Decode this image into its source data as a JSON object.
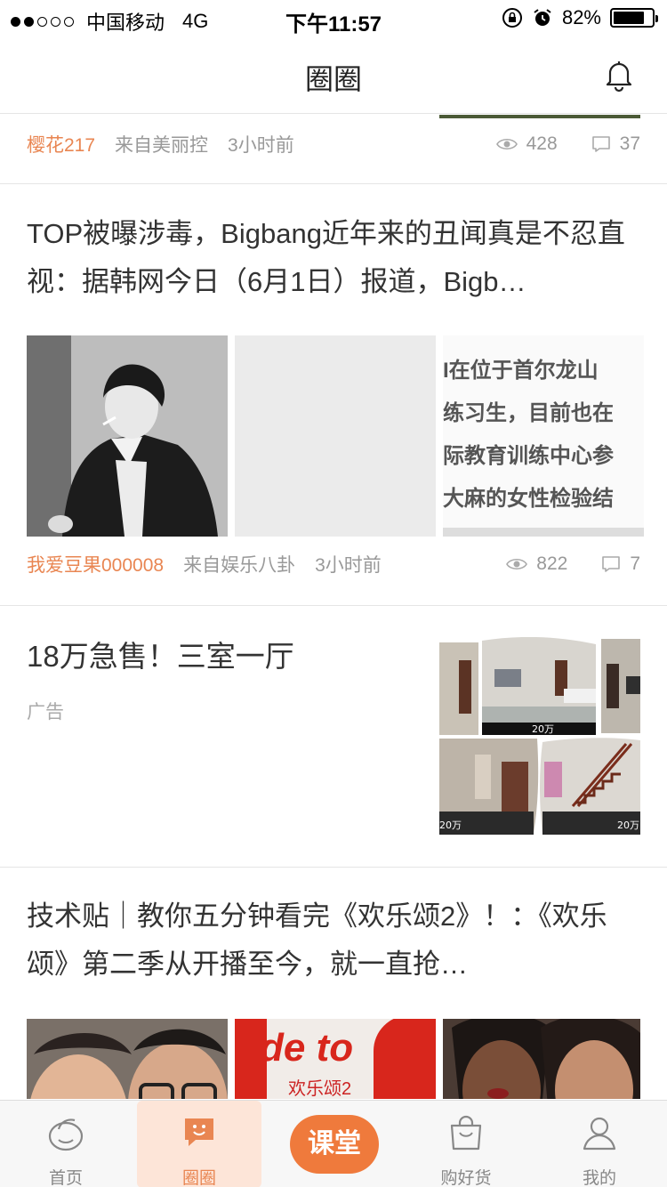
{
  "status": {
    "carrier": "中国移动",
    "network": "4G",
    "time": "下午11:57",
    "battery": "82%",
    "battery_level": 0.82
  },
  "nav": {
    "title": "圈圈"
  },
  "peek_post": {
    "author": "樱花217",
    "source": "来自美丽控",
    "time": "3小时前",
    "views": "428",
    "comments": "37"
  },
  "post1": {
    "title": "TOP被曝涉毒，Bigbang近年来的丑闻真是不忍直视：据韩网今日（6月1日）报道，Bigb…",
    "image_text": [
      "I在位于首尔龙山",
      "练习生，目前也在",
      "际教育训练中心参",
      "大麻的女性检验结"
    ],
    "author": "我爱豆果000008",
    "source": "来自娱乐八卦",
    "time": "3小时前",
    "views": "822",
    "comments": "7"
  },
  "ad": {
    "title": "18万急售！三室一厅",
    "label": "广告",
    "price_tags": [
      "20万",
      "20万",
      "20万"
    ]
  },
  "post2": {
    "title": "技术贴｜教你五分钟看完《欢乐颂2》！：《欢乐颂》第二季从开播至今，就一直抢…",
    "image_text": [
      "de to",
      "欢乐颂2"
    ]
  },
  "tabs": [
    {
      "label": "首页",
      "icon": "home-icon"
    },
    {
      "label": "圈圈",
      "icon": "chat-bubble-icon"
    },
    {
      "label": "课堂",
      "icon": "classroom-button"
    },
    {
      "label": "购好货",
      "icon": "shopping-bag-icon"
    },
    {
      "label": "我的",
      "icon": "profile-icon"
    }
  ],
  "colors": {
    "accent": "#e98652",
    "class_button": "#ef7a3c"
  }
}
